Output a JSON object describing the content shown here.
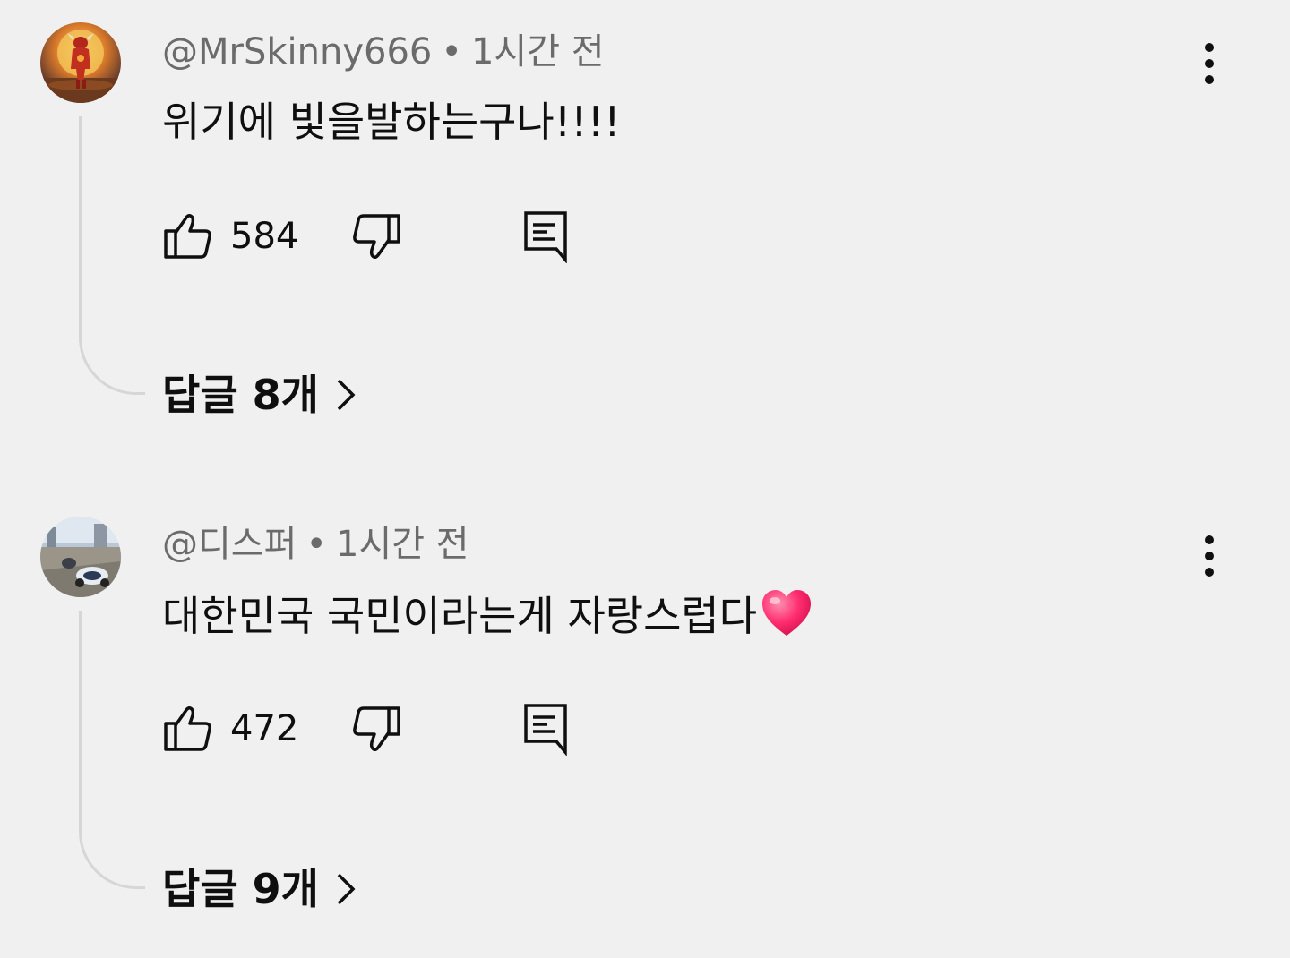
{
  "comments": [
    {
      "author": "@MrSkinny666",
      "separator": "•",
      "time": "1시간 전",
      "text": "위기에 빛을발하는구나!!!!",
      "likes": "584",
      "replies_label": "답글 8개",
      "avatar_icon": "bull-warrior-avatar"
    },
    {
      "author": "@디스퍼",
      "separator": "•",
      "time": "1시간 전",
      "text": "대한민국 국민이라는게 자랑스럽다",
      "text_emoji": "heart",
      "likes": "472",
      "replies_label": "답글 9개",
      "avatar_icon": "street-bikes-avatar"
    }
  ],
  "icons": {
    "like": "thumbs-up-icon",
    "dislike": "thumbs-down-icon",
    "reply": "reply-comment-icon",
    "more": "more-vertical-icon",
    "chevron": "chevron-right-icon"
  },
  "colors": {
    "background": "#f0f0f0",
    "text_primary": "#0f0f0f",
    "text_secondary": "#6b6b6b",
    "heart": "#ff2d6f"
  }
}
